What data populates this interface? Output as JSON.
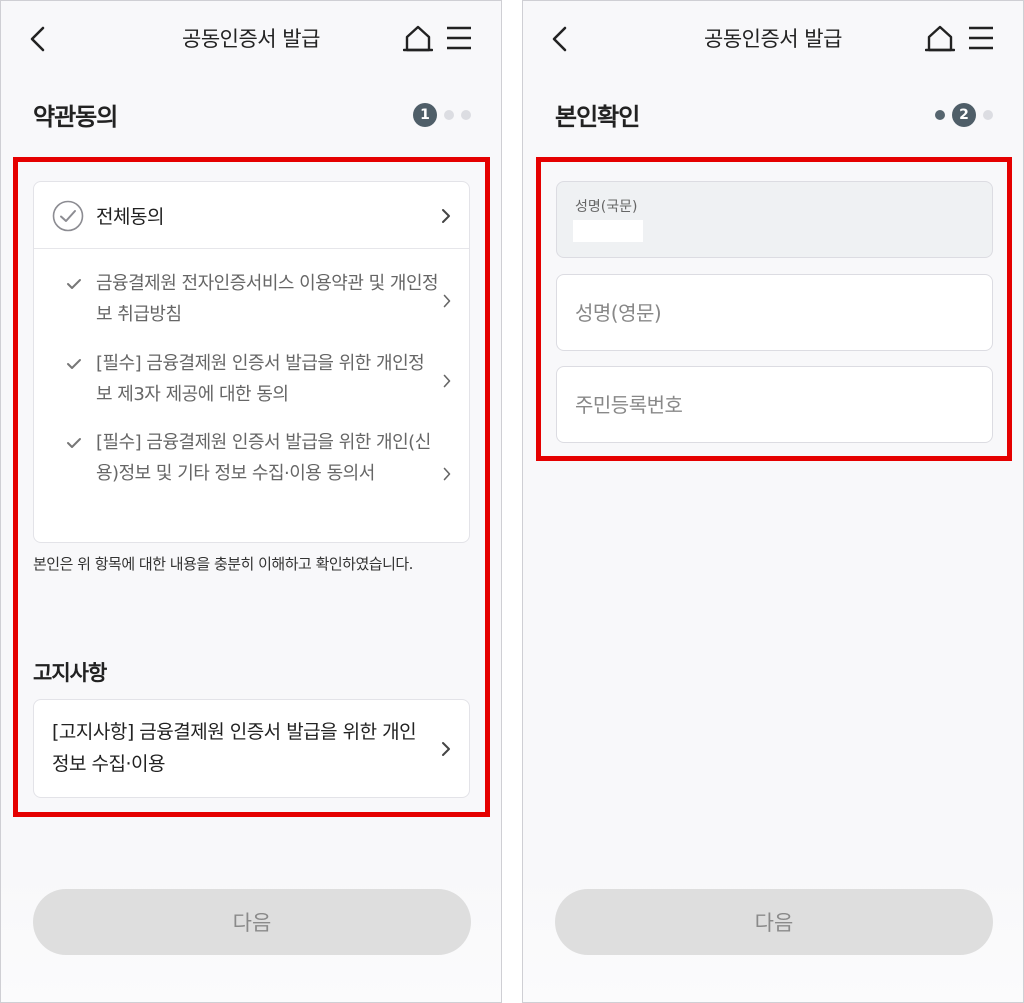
{
  "colors": {
    "highlight": "#e50000",
    "step_active": "#4f5e68",
    "button_disabled": "#dedede",
    "background": "#f8f8fa"
  },
  "left_screen": {
    "header": {
      "title": "공동인증서 발급",
      "icons": [
        "back-arrow-icon",
        "home-icon",
        "menu-icon"
      ]
    },
    "section_title": "약관동의",
    "step_indicator": {
      "current": "1",
      "total": 3
    },
    "agree_all_label": "전체동의",
    "terms": [
      {
        "text": "금융결제원 전자인증서비스 이용약관 및 개인정보 취급방침"
      },
      {
        "text": "[필수] 금융결제원 인증서 발급을 위한 개인정보 제3자 제공에 대한 동의"
      },
      {
        "text": "[필수] 금융결제원 인증서 발급을 위한 개인(신용)정보 및 기타 정보 수집·이용 동의서"
      }
    ],
    "confirm_text": "본인은 위 항목에 대한 내용을 충분히 이해하고 확인하였습니다.",
    "notice_title": "고지사항",
    "notice_item": "[고지사항] 금융결제원 인증서 발급을 위한 개인 정보 수집·이용",
    "next_button": "다음"
  },
  "right_screen": {
    "header": {
      "title": "공동인증서 발급",
      "icons": [
        "back-arrow-icon",
        "home-icon",
        "menu-icon"
      ]
    },
    "section_title": "본인확인",
    "step_indicator": {
      "current": "2",
      "total": 3
    },
    "fields": {
      "name_korean_label": "성명(국문)",
      "name_english_placeholder": "성명(영문)",
      "rrn_placeholder": "주민등록번호"
    },
    "next_button": "다음"
  }
}
